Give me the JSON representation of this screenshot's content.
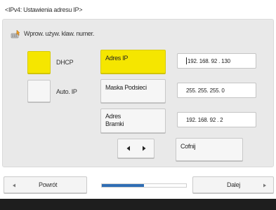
{
  "title": "<IPv4: Ustawienia adresu IP>",
  "hint": {
    "icon": "keyboard-icon",
    "text": "Wprow. używ. klaw. numer."
  },
  "options": {
    "dhcp": {
      "label": "DHCP",
      "selected": true
    },
    "auto_ip": {
      "label": "Auto. IP",
      "selected": false
    }
  },
  "fields": {
    "ip_address": {
      "label": "Adres IP",
      "value": "192. 168. 92 . 130",
      "active": true
    },
    "subnet_mask": {
      "label": "Maska Podsieci",
      "value": "255. 255. 255. 0",
      "active": false
    },
    "gateway": {
      "label_line1": "Adres",
      "label_line2": "Bramki",
      "value": "192. 168. 92 . 2",
      "active": false
    }
  },
  "cursor_buttons": {
    "left_icon": "arrow-left-icon",
    "right_icon": "arrow-right-icon"
  },
  "back_key": {
    "label": "Cofnij"
  },
  "footer": {
    "back_label": "Powrót",
    "next_label": "Dalej",
    "progress": 0.5
  },
  "colors": {
    "accent_yellow": "#f5e600",
    "progress_blue": "#2f6db4",
    "panel_bg": "#e9e9e9",
    "status_bar": "#1e1e1e"
  }
}
